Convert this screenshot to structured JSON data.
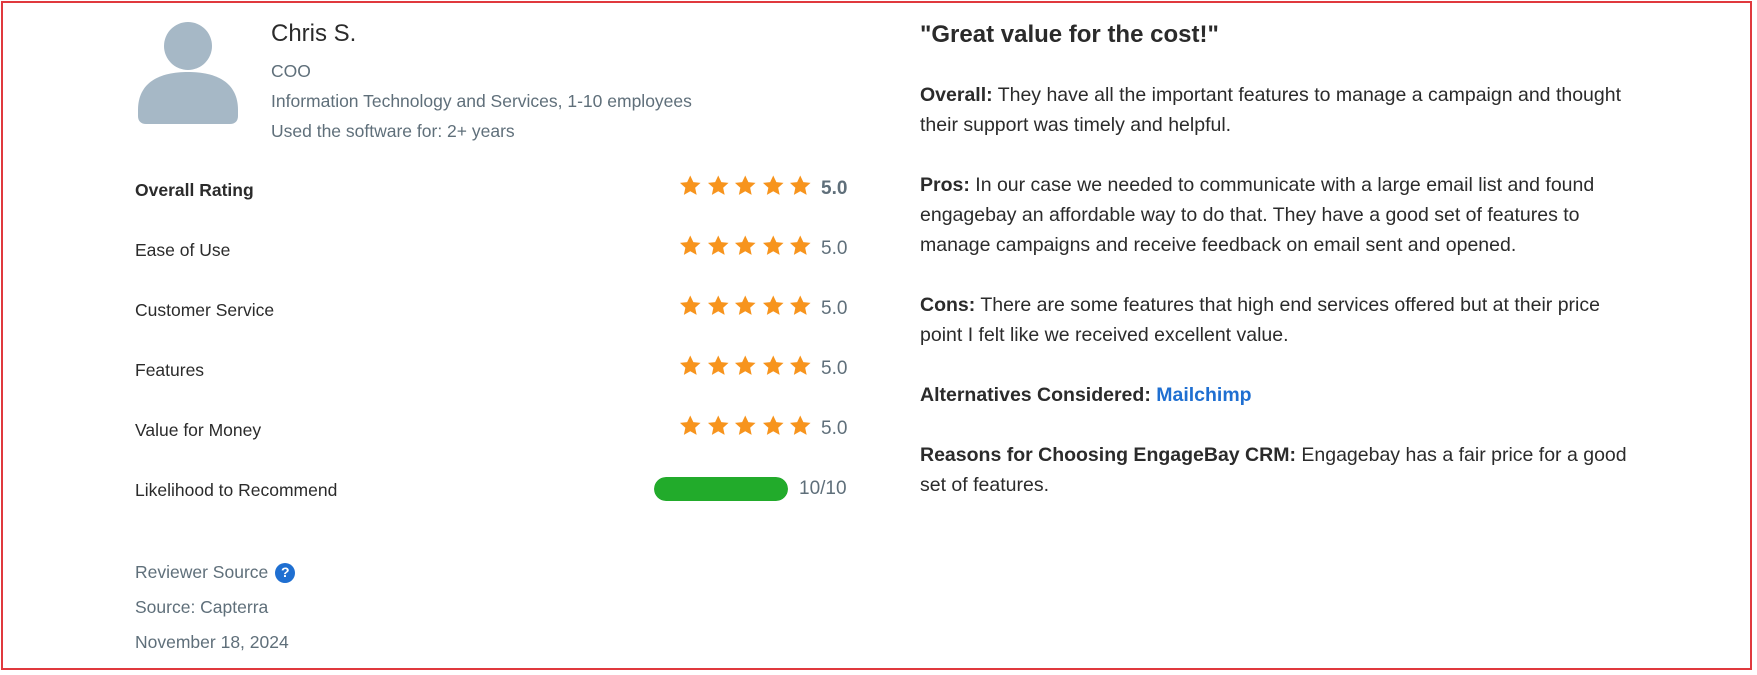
{
  "reviewer": {
    "name": "Chris S.",
    "role": "COO",
    "industry": "Information Technology and Services, 1-10 employees",
    "usage": "Used the software for: 2+ years",
    "avatar_icon": "user-avatar-icon"
  },
  "ratings": [
    {
      "label": "Overall Rating",
      "score": "5.0",
      "stars": 5
    },
    {
      "label": "Ease of Use",
      "score": "5.0",
      "stars": 5
    },
    {
      "label": "Customer Service",
      "score": "5.0",
      "stars": 5
    },
    {
      "label": "Features",
      "score": "5.0",
      "stars": 5
    },
    {
      "label": "Value for Money",
      "score": "5.0",
      "stars": 5
    }
  ],
  "recommend": {
    "label": "Likelihood to Recommend",
    "score": "10/10",
    "fraction": 1.0
  },
  "source": {
    "label": "Reviewer Source",
    "help_icon": "question-icon",
    "source_text": "Source: Capterra",
    "date": "November 18, 2024"
  },
  "review": {
    "title": "\"Great value for the cost!\"",
    "overall_label": "Overall:",
    "overall_text": " They have all the important features to manage a campaign and thought their support was timely and helpful.",
    "pros_label": "Pros:",
    "pros_text": " In our case we needed to communicate with a large email list and found engagebay an affordable way to do that. They have a good set of features to manage campaigns and receive feedback on email sent and opened.",
    "cons_label": "Cons:",
    "cons_text": " There are some features that high end services offered but at their price point I felt like we received excellent value.",
    "alternatives_label": "Alternatives Considered:",
    "alternatives_link": "Mailchimp",
    "reasons_label": "Reasons for Choosing EngageBay CRM:",
    "reasons_text": " Engagebay has a fair price for a good set of features."
  },
  "colors": {
    "star": "#f7941d",
    "bar": "#22ab2b",
    "link": "#1f6fd1",
    "border": "#e0393e",
    "muted_text": "#5f6f7a",
    "avatar": "#a6b8c6"
  }
}
